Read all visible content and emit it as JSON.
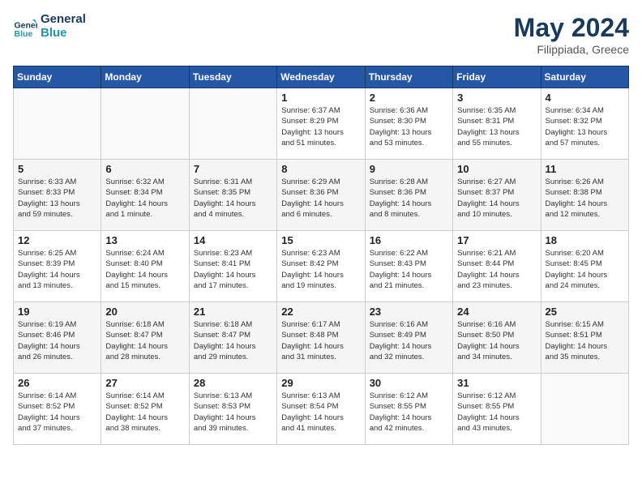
{
  "header": {
    "logo_line1": "General",
    "logo_line2": "Blue",
    "title": "May 2024",
    "subtitle": "Filippiada, Greece"
  },
  "weekdays": [
    "Sunday",
    "Monday",
    "Tuesday",
    "Wednesday",
    "Thursday",
    "Friday",
    "Saturday"
  ],
  "weeks": [
    [
      {
        "day": "",
        "info": ""
      },
      {
        "day": "",
        "info": ""
      },
      {
        "day": "",
        "info": ""
      },
      {
        "day": "1",
        "info": "Sunrise: 6:37 AM\nSunset: 8:29 PM\nDaylight: 13 hours\nand 51 minutes."
      },
      {
        "day": "2",
        "info": "Sunrise: 6:36 AM\nSunset: 8:30 PM\nDaylight: 13 hours\nand 53 minutes."
      },
      {
        "day": "3",
        "info": "Sunrise: 6:35 AM\nSunset: 8:31 PM\nDaylight: 13 hours\nand 55 minutes."
      },
      {
        "day": "4",
        "info": "Sunrise: 6:34 AM\nSunset: 8:32 PM\nDaylight: 13 hours\nand 57 minutes."
      }
    ],
    [
      {
        "day": "5",
        "info": "Sunrise: 6:33 AM\nSunset: 8:33 PM\nDaylight: 13 hours\nand 59 minutes."
      },
      {
        "day": "6",
        "info": "Sunrise: 6:32 AM\nSunset: 8:34 PM\nDaylight: 14 hours\nand 1 minute."
      },
      {
        "day": "7",
        "info": "Sunrise: 6:31 AM\nSunset: 8:35 PM\nDaylight: 14 hours\nand 4 minutes."
      },
      {
        "day": "8",
        "info": "Sunrise: 6:29 AM\nSunset: 8:36 PM\nDaylight: 14 hours\nand 6 minutes."
      },
      {
        "day": "9",
        "info": "Sunrise: 6:28 AM\nSunset: 8:36 PM\nDaylight: 14 hours\nand 8 minutes."
      },
      {
        "day": "10",
        "info": "Sunrise: 6:27 AM\nSunset: 8:37 PM\nDaylight: 14 hours\nand 10 minutes."
      },
      {
        "day": "11",
        "info": "Sunrise: 6:26 AM\nSunset: 8:38 PM\nDaylight: 14 hours\nand 12 minutes."
      }
    ],
    [
      {
        "day": "12",
        "info": "Sunrise: 6:25 AM\nSunset: 8:39 PM\nDaylight: 14 hours\nand 13 minutes."
      },
      {
        "day": "13",
        "info": "Sunrise: 6:24 AM\nSunset: 8:40 PM\nDaylight: 14 hours\nand 15 minutes."
      },
      {
        "day": "14",
        "info": "Sunrise: 6:23 AM\nSunset: 8:41 PM\nDaylight: 14 hours\nand 17 minutes."
      },
      {
        "day": "15",
        "info": "Sunrise: 6:23 AM\nSunset: 8:42 PM\nDaylight: 14 hours\nand 19 minutes."
      },
      {
        "day": "16",
        "info": "Sunrise: 6:22 AM\nSunset: 8:43 PM\nDaylight: 14 hours\nand 21 minutes."
      },
      {
        "day": "17",
        "info": "Sunrise: 6:21 AM\nSunset: 8:44 PM\nDaylight: 14 hours\nand 23 minutes."
      },
      {
        "day": "18",
        "info": "Sunrise: 6:20 AM\nSunset: 8:45 PM\nDaylight: 14 hours\nand 24 minutes."
      }
    ],
    [
      {
        "day": "19",
        "info": "Sunrise: 6:19 AM\nSunset: 8:46 PM\nDaylight: 14 hours\nand 26 minutes."
      },
      {
        "day": "20",
        "info": "Sunrise: 6:18 AM\nSunset: 8:47 PM\nDaylight: 14 hours\nand 28 minutes."
      },
      {
        "day": "21",
        "info": "Sunrise: 6:18 AM\nSunset: 8:47 PM\nDaylight: 14 hours\nand 29 minutes."
      },
      {
        "day": "22",
        "info": "Sunrise: 6:17 AM\nSunset: 8:48 PM\nDaylight: 14 hours\nand 31 minutes."
      },
      {
        "day": "23",
        "info": "Sunrise: 6:16 AM\nSunset: 8:49 PM\nDaylight: 14 hours\nand 32 minutes."
      },
      {
        "day": "24",
        "info": "Sunrise: 6:16 AM\nSunset: 8:50 PM\nDaylight: 14 hours\nand 34 minutes."
      },
      {
        "day": "25",
        "info": "Sunrise: 6:15 AM\nSunset: 8:51 PM\nDaylight: 14 hours\nand 35 minutes."
      }
    ],
    [
      {
        "day": "26",
        "info": "Sunrise: 6:14 AM\nSunset: 8:52 PM\nDaylight: 14 hours\nand 37 minutes."
      },
      {
        "day": "27",
        "info": "Sunrise: 6:14 AM\nSunset: 8:52 PM\nDaylight: 14 hours\nand 38 minutes."
      },
      {
        "day": "28",
        "info": "Sunrise: 6:13 AM\nSunset: 8:53 PM\nDaylight: 14 hours\nand 39 minutes."
      },
      {
        "day": "29",
        "info": "Sunrise: 6:13 AM\nSunset: 8:54 PM\nDaylight: 14 hours\nand 41 minutes."
      },
      {
        "day": "30",
        "info": "Sunrise: 6:12 AM\nSunset: 8:55 PM\nDaylight: 14 hours\nand 42 minutes."
      },
      {
        "day": "31",
        "info": "Sunrise: 6:12 AM\nSunset: 8:55 PM\nDaylight: 14 hours\nand 43 minutes."
      },
      {
        "day": "",
        "info": ""
      }
    ]
  ]
}
